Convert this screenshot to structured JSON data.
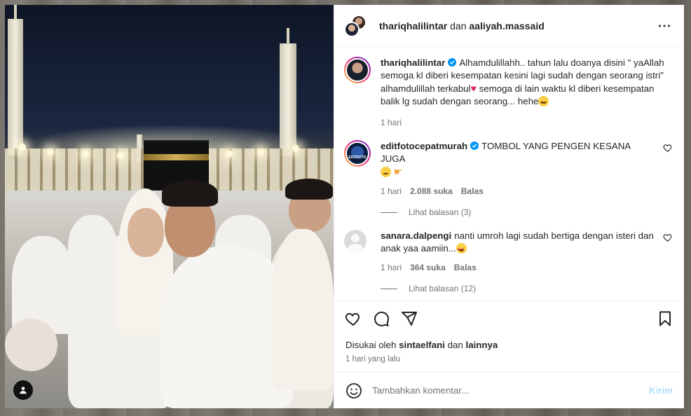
{
  "header": {
    "user1": "thariqhalilintar",
    "joiner": "dan",
    "user2": "aaliyah.massaid"
  },
  "caption": {
    "user": "thariqhalilintar",
    "text_part1": "Alhamdulillahh.. tahun lalu doanya disini \" yaAllah semoga kl diberi kesempatan kesini lagi sudah dengan seorang istri\" alhamdulillah terkabul",
    "text_part2": " semoga di lain waktu kl diberi kesempatan balik lg sudah dengan seorang... hehe",
    "time": "1 hari"
  },
  "comments": [
    {
      "user": "editfotocepatmurah",
      "avatar_text": "EDITFOTO",
      "text": "TOMBOL YANG PENGEN KESANA JUGA",
      "time": "1 hari",
      "likes": "2.088 suka",
      "reply": "Balas",
      "view_replies": "Lihat balasan (3)"
    },
    {
      "user": "sanara.dalpengi",
      "text": "nanti umroh lagi sudah bertiga dengan isteri dan anak yaa aamiin...",
      "time": "1 hari",
      "likes": "364 suka",
      "reply": "Balas",
      "view_replies": "Lihat balasan (12)"
    }
  ],
  "liked_by": {
    "prefix": "Disukai oleh",
    "user": "sintaelfani",
    "joiner": "dan",
    "others": "lainnya"
  },
  "post_time": "1 hari yang lalu",
  "composer": {
    "placeholder": "Tambahkan komentar...",
    "post_label": "Kirim"
  },
  "colors": {
    "verified": "#0095f6",
    "post_button_disabled": "#b2dffc",
    "text": "#262626",
    "secondary": "#737373"
  },
  "icons": [
    "more-icon",
    "verified-icon",
    "heart-icon",
    "comment-icon",
    "share-icon",
    "bookmark-icon",
    "emoji-icon",
    "user-tag-icon"
  ]
}
